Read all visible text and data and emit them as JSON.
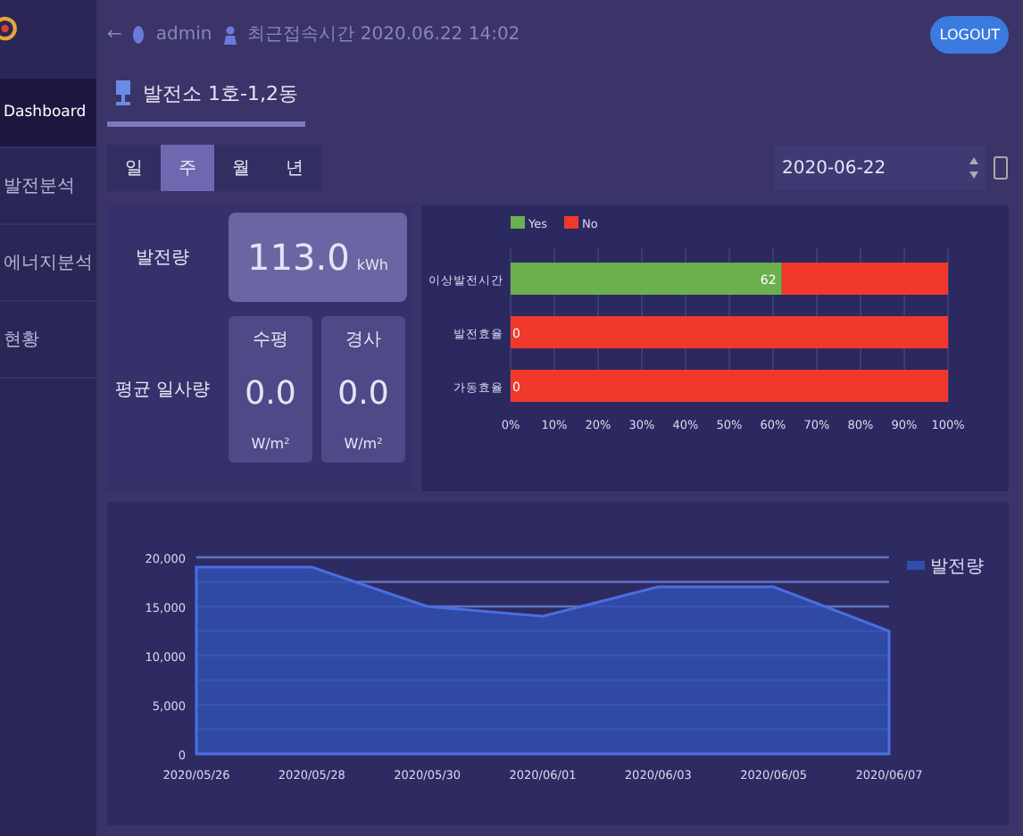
{
  "sidebar": {
    "items": [
      {
        "label": "Dashboard",
        "selected": true
      },
      {
        "label": "발전분석",
        "selected": false
      },
      {
        "label": "에너지분석",
        "selected": false
      },
      {
        "label": "현황",
        "selected": false
      }
    ]
  },
  "header": {
    "back": "←",
    "user": "admin",
    "last_login": "최근접속시간 2020.06.22 14:02",
    "logout": "LOGOUT"
  },
  "page_title": "발전소 1호-1,2동",
  "period_tabs": [
    {
      "label": "일",
      "selected": false
    },
    {
      "label": "주",
      "selected": true
    },
    {
      "label": "월",
      "selected": false
    },
    {
      "label": "년",
      "selected": false
    }
  ],
  "date_field": {
    "value": "2020-06-22"
  },
  "generation": {
    "label": "발전량",
    "value": "113.0",
    "unit": "kWh"
  },
  "irradiance": {
    "label": "평균 일사량",
    "cards": [
      {
        "title": "수평",
        "value": "0.0",
        "unit": "W/m²"
      },
      {
        "title": "경사",
        "value": "0.0",
        "unit": "W/m²"
      }
    ]
  },
  "bar_chart": {
    "chart_data": {
      "type": "bar",
      "orientation": "horizontal",
      "stacked": true,
      "categories": [
        "이상발전시간",
        "발전효율",
        "가동효율"
      ],
      "series": [
        {
          "name": "Yes",
          "color": "#6ab04c",
          "values": [
            62,
            0,
            0
          ],
          "value_labels": [
            "62",
            "0",
            "0"
          ]
        },
        {
          "name": "No",
          "color": "#f0392b",
          "values": [
            38,
            100,
            100
          ],
          "value_labels": [
            null,
            null,
            null
          ]
        }
      ],
      "grid": true,
      "legend": true,
      "xlim": [
        0,
        100
      ],
      "xticks": [
        {
          "value": 0,
          "label": "0%"
        },
        {
          "value": 10,
          "label": "10%"
        },
        {
          "value": 20,
          "label": "20%"
        },
        {
          "value": 30,
          "label": "30%"
        },
        {
          "value": 40,
          "label": "40%"
        },
        {
          "value": 50,
          "label": "50%"
        },
        {
          "value": 60,
          "label": "60%"
        },
        {
          "value": 70,
          "label": "70%"
        },
        {
          "value": 80,
          "label": "80%"
        },
        {
          "value": 90,
          "label": "90%"
        },
        {
          "value": 100,
          "label": "100%"
        }
      ],
      "data_labels": "value_labels"
    }
  },
  "area_chart": {
    "chart_data": {
      "type": "area",
      "categories": [
        "2020/05/26",
        "2020/05/28",
        "2020/05/30",
        "2020/06/01",
        "2020/06/03",
        "2020/06/05",
        "2020/06/07"
      ],
      "series": [
        {
          "name": "발전량",
          "type": "area",
          "color": "#2f4fb0",
          "values": [
            19000,
            19000,
            15000,
            14000,
            17000,
            17000,
            12500
          ]
        }
      ],
      "ylim": [
        0,
        20000
      ],
      "grid": true,
      "yticks": [
        {
          "value": 0,
          "label": "0"
        },
        {
          "value": 5000,
          "label": "5,000"
        },
        {
          "value": 10000,
          "label": "10,000"
        },
        {
          "value": 15000,
          "label": "15,000"
        },
        {
          "value": 20000,
          "label": "20,000"
        }
      ]
    }
  }
}
